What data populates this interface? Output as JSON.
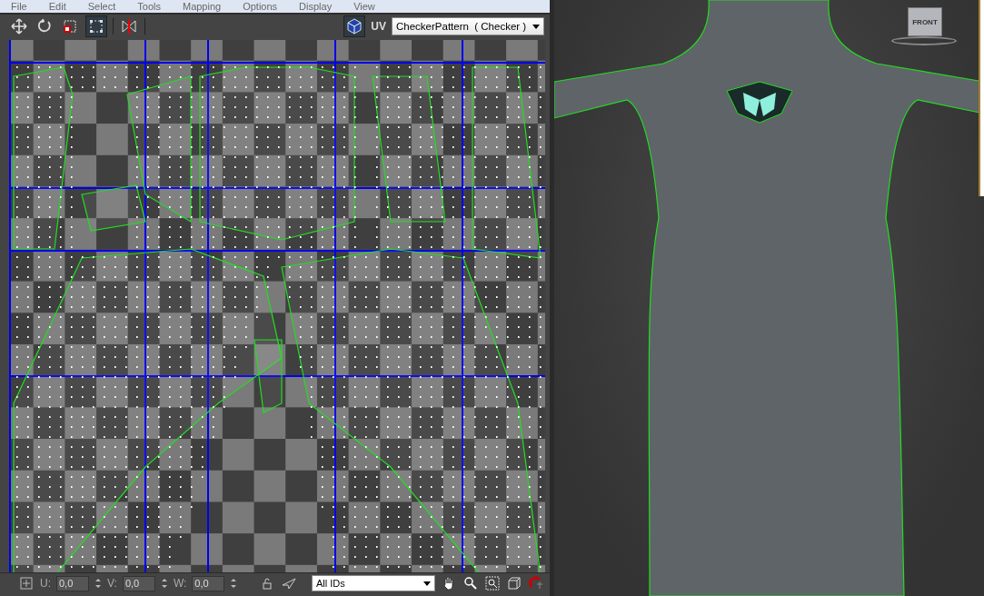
{
  "menu": [
    {
      "label": "File"
    },
    {
      "label": "Edit"
    },
    {
      "label": "Select"
    },
    {
      "label": "Tools"
    },
    {
      "label": "Mapping"
    },
    {
      "label": "Options"
    },
    {
      "label": "Display"
    },
    {
      "label": "View"
    }
  ],
  "toolbar": {
    "uv_label": "UV",
    "texture_dropdown": {
      "value": "CheckerPattern  ( Checker )"
    }
  },
  "status_bar": {
    "fields": [
      {
        "label": "U:",
        "value": "0,0"
      },
      {
        "label": "V:",
        "value": "0,0"
      },
      {
        "label": "W:",
        "value": "0,0"
      }
    ],
    "id_filter": {
      "value": "All IDs"
    }
  },
  "viewport": {
    "viewcube_label": "FRONT"
  }
}
